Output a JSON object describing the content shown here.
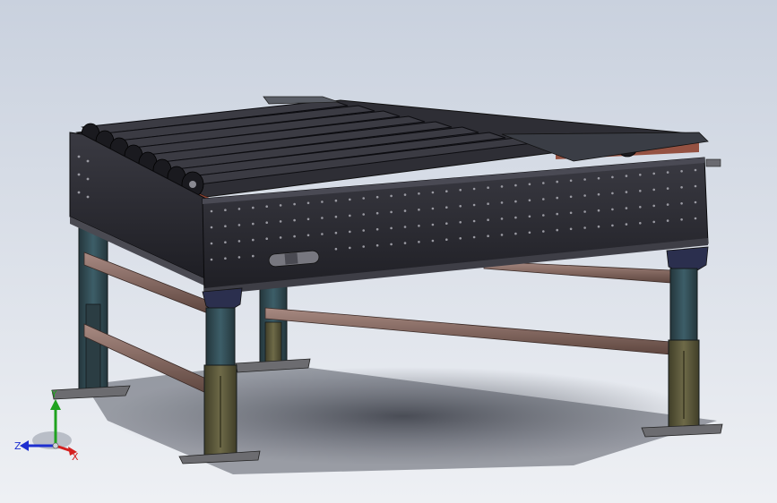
{
  "viewport": {
    "background_top": "#c9d1de",
    "background_bottom": "#eef0f4"
  },
  "model": {
    "frame_color": "#2a2a30",
    "roller_color": "#35353c",
    "roller_accent": "#b84a2e",
    "brace_color": "#8a6a62",
    "leg_color": "#2f4a52",
    "leg_base_color": "#58563a"
  },
  "triad": {
    "x_label": "X",
    "y_label": "Y",
    "z_label": "Z",
    "x_color": "#d42020",
    "y_color": "#1fa31f",
    "z_color": "#1e2fd0"
  }
}
